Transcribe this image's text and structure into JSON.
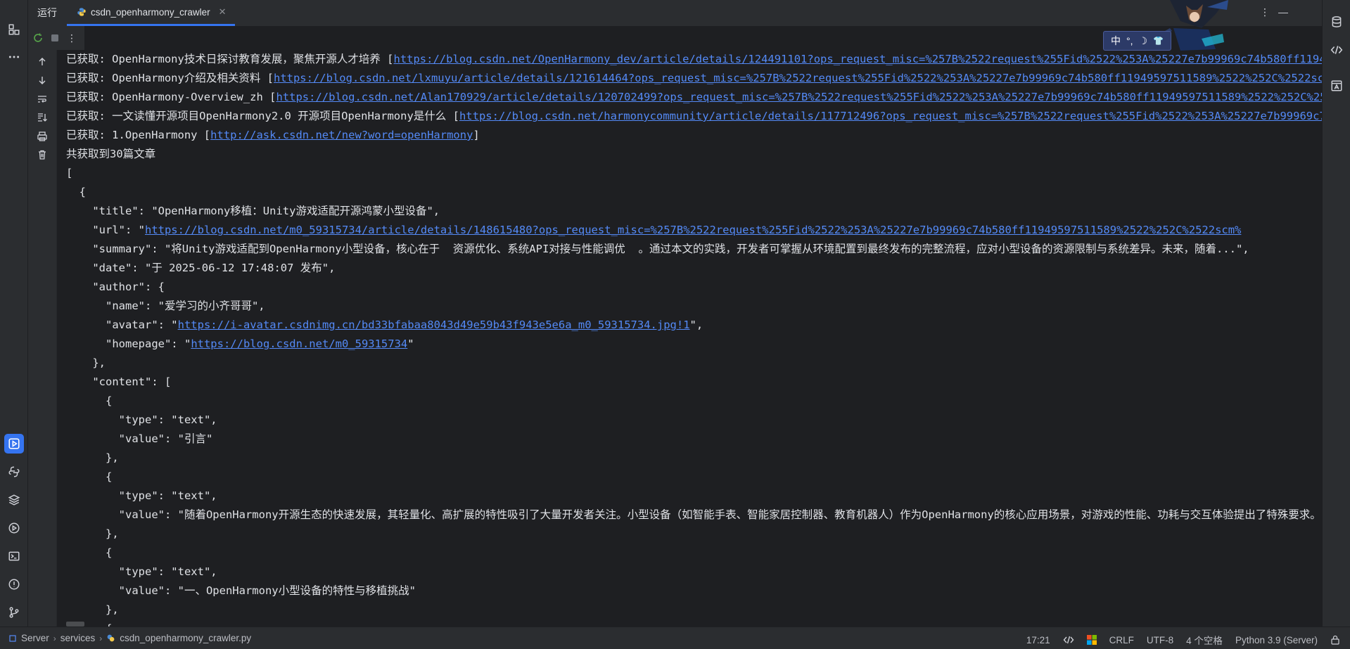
{
  "header": {
    "run_label": "运行",
    "tab_label": "csdn_openharmony_crawler"
  },
  "console": {
    "lines": [
      {
        "text": "已获取: OpenHarmony技术日探讨教育发展，聚焦开源人才培养 [",
        "link": "https://blog.csdn.net/OpenHarmony_dev/article/details/124491101?ops_request_misc=%257B%2522request%255Fid%2522%253A%25227e7b99969c74b580ff11949597511589%2522%252C%2522scm%",
        "tail": ""
      },
      {
        "text": "已获取: OpenHarmony介绍及相关资料 [",
        "link": "https://blog.csdn.net/lxmuyu/article/details/121614464?ops_request_misc=%257B%2522request%255Fid%2522%253A%25227e7b99969c74b580ff11949597511589%2522%252C%2522scm%",
        "tail": ""
      },
      {
        "text": "已获取: OpenHarmony-Overview_zh [",
        "link": "https://blog.csdn.net/Alan170929/article/details/120702499?ops_request_misc=%257B%2522request%255Fid%2522%253A%25227e7b99969c74b580ff11949597511589%2522%252C%2522scm%",
        "tail": ""
      },
      {
        "text": "已获取: 一文读懂开源项目OpenHarmony2.0 开源项目OpenHarmony是什么 [",
        "link": "https://blog.csdn.net/harmonycommunity/article/details/117712496?ops_request_misc=%257B%2522request%255Fid%2522%253A%25227e7b99969c74b580ff11949597511589%2522",
        "tail": ""
      },
      {
        "text": "已获取: 1.OpenHarmony [",
        "link": "http://ask.csdn.net/new?word=openHarmony",
        "tail": "]"
      },
      {
        "text": "共获取到30篇文章",
        "link": "",
        "tail": ""
      },
      {
        "text": "[",
        "link": "",
        "tail": ""
      },
      {
        "text": "  {",
        "link": "",
        "tail": ""
      },
      {
        "text": "    \"title\": \"OpenHarmony移植：Unity游戏适配开源鸿蒙小型设备\",",
        "link": "",
        "tail": ""
      },
      {
        "text": "    \"url\": \"",
        "link": "https://blog.csdn.net/m0_59315734/article/details/148615480?ops_request_misc=%257B%2522request%255Fid%2522%253A%25227e7b99969c74b580ff11949597511589%2522%252C%2522scm%",
        "tail": ""
      },
      {
        "text": "    \"summary\": \"将Unity游戏适配到OpenHarmony小型设备，核心在于  资源优化、系统API对接与性能调优  。通过本文的实践，开发者可掌握从环境配置到最终发布的完整流程，应对小型设备的资源限制与系统差异。未来，随着...\",",
        "link": "",
        "tail": ""
      },
      {
        "text": "    \"date\": \"于 2025-06-12 17:48:07 发布\",",
        "link": "",
        "tail": ""
      },
      {
        "text": "    \"author\": {",
        "link": "",
        "tail": ""
      },
      {
        "text": "      \"name\": \"爱学习的小齐哥哥\",",
        "link": "",
        "tail": ""
      },
      {
        "text": "      \"avatar\": \"",
        "link": "https://i-avatar.csdnimg.cn/bd33bfabaa8043d49e59b43f943e5e6a_m0_59315734.jpg!1",
        "tail": "\","
      },
      {
        "text": "      \"homepage\": \"",
        "link": "https://blog.csdn.net/m0_59315734",
        "tail": "\""
      },
      {
        "text": "    },",
        "link": "",
        "tail": ""
      },
      {
        "text": "    \"content\": [",
        "link": "",
        "tail": ""
      },
      {
        "text": "      {",
        "link": "",
        "tail": ""
      },
      {
        "text": "        \"type\": \"text\",",
        "link": "",
        "tail": ""
      },
      {
        "text": "        \"value\": \"引言\"",
        "link": "",
        "tail": ""
      },
      {
        "text": "      },",
        "link": "",
        "tail": ""
      },
      {
        "text": "      {",
        "link": "",
        "tail": ""
      },
      {
        "text": "        \"type\": \"text\",",
        "link": "",
        "tail": ""
      },
      {
        "text": "        \"value\": \"随着OpenHarmony开源生态的快速发展，其轻量化、高扩展的特性吸引了大量开发者关注。小型设备（如智能手表、智能家居控制器、教育机器人）作为OpenHarmony的核心应用场景，对游戏的性能、功耗与交互体验提出了特殊要求。\",",
        "link": "",
        "tail": ""
      },
      {
        "text": "      },",
        "link": "",
        "tail": ""
      },
      {
        "text": "      {",
        "link": "",
        "tail": ""
      },
      {
        "text": "        \"type\": \"text\",",
        "link": "",
        "tail": ""
      },
      {
        "text": "        \"value\": \"一、OpenHarmony小型设备的特性与移植挑战\"",
        "link": "",
        "tail": ""
      },
      {
        "text": "      },",
        "link": "",
        "tail": ""
      },
      {
        "text": "      {",
        "link": "",
        "tail": ""
      }
    ]
  },
  "ime": {
    "mode": "中",
    "punct": "°,",
    "moon": "☽",
    "shirt": "👕"
  },
  "status": {
    "breadcrumb": [
      "Server",
      "services",
      "csdn_openharmony_crawler.py"
    ],
    "position": "17:21",
    "line_ending": "CRLF",
    "encoding": "UTF-8",
    "indent": "4 个空格",
    "interpreter": "Python 3.9 (Server)"
  },
  "colors": {
    "accent": "#3574f0",
    "link": "#548af7",
    "background": "#1e1f22",
    "panel": "#2b2d30"
  }
}
